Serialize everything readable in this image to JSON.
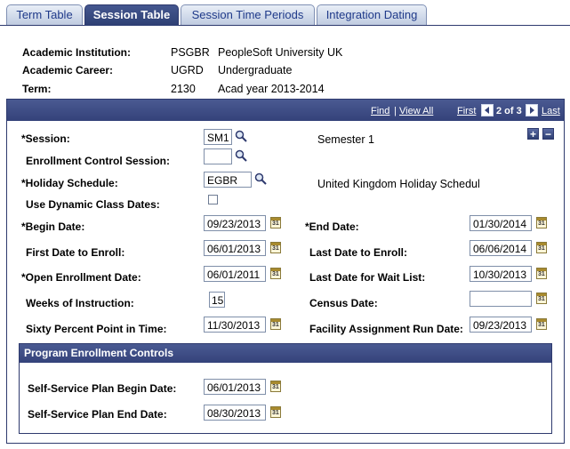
{
  "tabs": [
    {
      "label": "Term Table",
      "active": false
    },
    {
      "label": "Session Table",
      "active": true
    },
    {
      "label": "Session Time Periods",
      "active": false
    },
    {
      "label": "Integration Dating",
      "active": false
    }
  ],
  "header": {
    "institution": {
      "label": "Academic Institution:",
      "code": "PSGBR",
      "desc": "PeopleSoft University UK"
    },
    "career": {
      "label": "Academic Career:",
      "code": "UGRD",
      "desc": "Undergraduate"
    },
    "term": {
      "label": "Term:",
      "code": "2130",
      "desc": "Acad year 2013-2014"
    }
  },
  "nav": {
    "find": "Find",
    "sep": "|",
    "view_all": "View All",
    "first": "First",
    "position": "2 of 3",
    "last": "Last"
  },
  "form": {
    "session": {
      "label": "*Session:",
      "value": "SM1",
      "desc": "Semester 1"
    },
    "enrollment_control_session": {
      "label": "Enrollment Control Session:",
      "value": ""
    },
    "holiday_schedule": {
      "label": "*Holiday Schedule:",
      "value": "EGBR",
      "desc": "United Kingdom Holiday Schedul"
    },
    "use_dynamic_class_dates": {
      "label": "Use Dynamic Class Dates:",
      "checked": false
    },
    "begin_date": {
      "label": "*Begin Date:",
      "value": "09/23/2013"
    },
    "end_date": {
      "label": "*End Date:",
      "value": "01/30/2014"
    },
    "first_date_to_enroll": {
      "label": "First Date to Enroll:",
      "value": "06/01/2013"
    },
    "last_date_to_enroll": {
      "label": "Last Date to Enroll:",
      "value": "06/06/2014"
    },
    "open_enrollment_date": {
      "label": "*Open Enrollment Date:",
      "value": "06/01/2011"
    },
    "last_date_wait_list": {
      "label": "Last Date for Wait List:",
      "value": "10/30/2013"
    },
    "weeks_of_instruction": {
      "label": "Weeks of Instruction:",
      "value": "15"
    },
    "census_date": {
      "label": "Census Date:",
      "value": ""
    },
    "sixty_percent_point": {
      "label": "Sixty Percent Point in Time:",
      "value": "11/30/2013"
    },
    "facility_assignment_run_date": {
      "label": "Facility Assignment Run Date:",
      "value": "09/23/2013"
    }
  },
  "program_enrollment": {
    "title": "Program Enrollment Controls",
    "plan_begin": {
      "label": "Self-Service Plan Begin Date:",
      "value": "06/01/2013"
    },
    "plan_end": {
      "label": "Self-Service Plan End Date:",
      "value": "08/30/2013"
    }
  },
  "calendar_icon_text": "31",
  "row_controls": {
    "add": "+",
    "remove": "−"
  },
  "colors": {
    "navy": "#34427a",
    "link": "#1f3a8a"
  }
}
